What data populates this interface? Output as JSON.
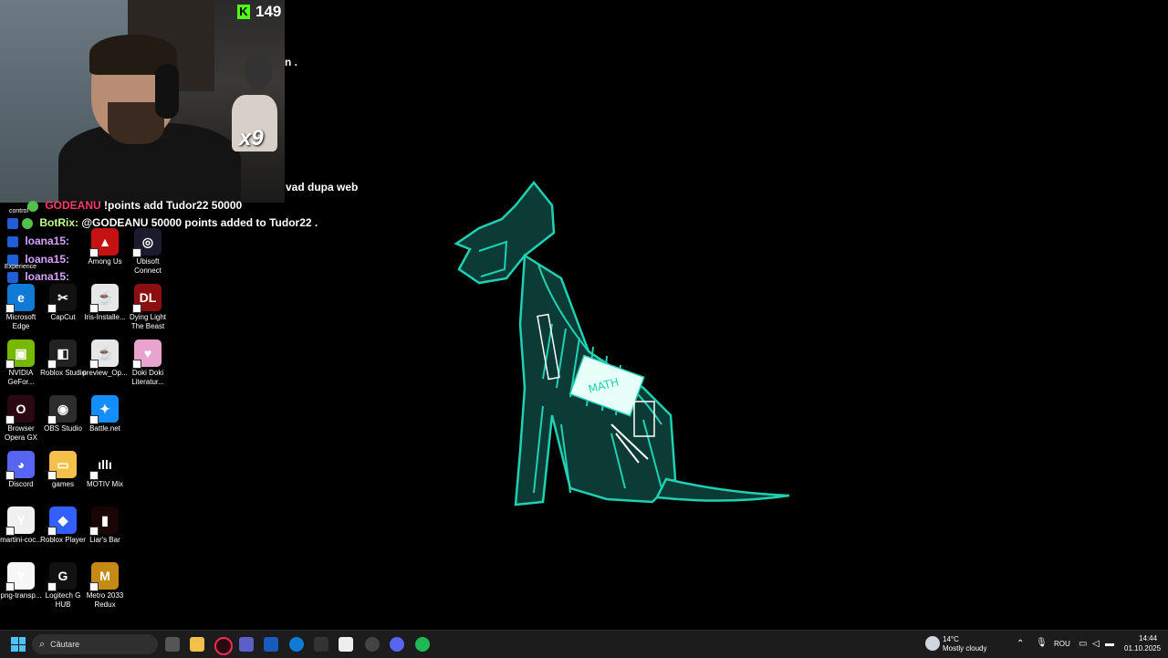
{
  "stream": {
    "kick_viewers": "149",
    "cat_overlay_label": "x9",
    "chat": [
      {
        "badge": "",
        "user": "GODEANU",
        "text": "!points add Tudor22 50000"
      },
      {
        "badge": "",
        "user": "BotRix:",
        "text": "@GODEANU 50000 points added to Tudor22 ."
      },
      {
        "user": "loana15:",
        "text": ""
      },
      {
        "user": "loana15:",
        "text": ""
      },
      {
        "user": "loana15:",
        "text": ""
      }
    ],
    "chat_fragment_1": "n .",
    "chat_fragment_2": "vad dupa web"
  },
  "desktop": {
    "icons": [
      {
        "label": "Among Us",
        "color": "#c51111",
        "glyph": "▲"
      },
      {
        "label": "Ubisoft Connect",
        "color": "#1b1b2d",
        "glyph": "◎"
      },
      {
        "label": "Microsoft Edge",
        "color": "#0f7bd6",
        "glyph": "e"
      },
      {
        "label": "CapCut",
        "color": "#111",
        "glyph": "✂"
      },
      {
        "label": "Iris-Installe...",
        "color": "#e7e7e7",
        "glyph": "☕"
      },
      {
        "label": "Dying Light The Beast",
        "color": "#8b0f0f",
        "glyph": "DL"
      },
      {
        "label": "NVIDIA GeFor...",
        "color": "#76b900",
        "glyph": "▣"
      },
      {
        "label": "Roblox Studio",
        "color": "#222",
        "glyph": "◧"
      },
      {
        "label": "preview_Op...",
        "color": "#e7e7e7",
        "glyph": "☕"
      },
      {
        "label": "Doki Doki Literatur...",
        "color": "#e9a3cf",
        "glyph": "♥"
      },
      {
        "label": "Browser Opera GX",
        "color": "#2a0a10",
        "glyph": "O"
      },
      {
        "label": "OBS Studio",
        "color": "#2d2d2d",
        "glyph": "◉"
      },
      {
        "label": "Battle.net",
        "color": "#148eff",
        "glyph": "✦"
      },
      {
        "label": "Discord",
        "color": "#5865f2",
        "glyph": "◕"
      },
      {
        "label": "games",
        "color": "#f3c04a",
        "glyph": "▭"
      },
      {
        "label": "MOTIV Mix",
        "color": "#000",
        "glyph": "ıllı"
      },
      {
        "label": "martini-coc...",
        "color": "#f0f0f0",
        "glyph": "Y"
      },
      {
        "label": "Roblox Player",
        "color": "#335fff",
        "glyph": "◆"
      },
      {
        "label": "Liar's Bar",
        "color": "#1a0505",
        "glyph": "▮"
      },
      {
        "label": "png-transp...",
        "color": "#f7f7f7",
        "glyph": "Y"
      },
      {
        "label": "Logitech G HUB",
        "color": "#111",
        "glyph": "G"
      },
      {
        "label": "Metro 2033 Redux",
        "color": "#c58a16",
        "glyph": "M"
      }
    ],
    "partial_labels": [
      "control",
      "Experience"
    ]
  },
  "taskbar": {
    "search_placeholder": "Căutare",
    "weather_temp": "14°C",
    "weather_desc": "Mostly cloudy",
    "language": "ROU",
    "time": "14:44",
    "date": "01.10.2025"
  },
  "colors": {
    "xray": "#1fd0b5",
    "xray_fill": "#0b3b34"
  }
}
